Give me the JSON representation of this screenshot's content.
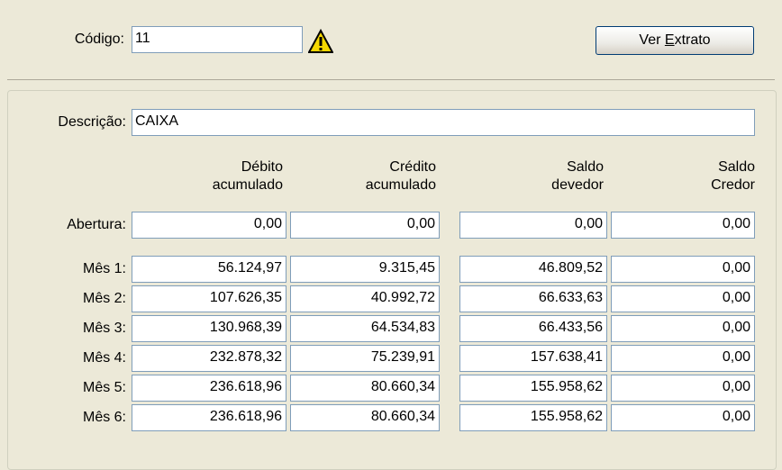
{
  "header": {
    "codigo_label": "Código:",
    "codigo_value": "11",
    "warning_icon": "warning-triangle-icon",
    "button_pre": "Ver ",
    "button_ul": "E",
    "button_post": "xtrato"
  },
  "form": {
    "descricao_label": "Descrição:",
    "descricao_value": "CAIXA",
    "columns": [
      "Débito\nacumulado",
      "Crédito\nacumulado",
      "Saldo\ndevedor",
      "Saldo\nCredor"
    ],
    "rows": [
      {
        "label": "Abertura:",
        "values": [
          "0,00",
          "0,00",
          "0,00",
          "0,00"
        ]
      },
      {
        "label": "Mês 1:",
        "values": [
          "56.124,97",
          "9.315,45",
          "46.809,52",
          "0,00"
        ]
      },
      {
        "label": "Mês 2:",
        "values": [
          "107.626,35",
          "40.992,72",
          "66.633,63",
          "0,00"
        ]
      },
      {
        "label": "Mês 3:",
        "values": [
          "130.968,39",
          "64.534,83",
          "66.433,56",
          "0,00"
        ]
      },
      {
        "label": "Mês 4:",
        "values": [
          "232.878,32",
          "75.239,91",
          "157.638,41",
          "0,00"
        ]
      },
      {
        "label": "Mês 5:",
        "values": [
          "236.618,96",
          "80.660,34",
          "155.958,62",
          "0,00"
        ]
      },
      {
        "label": "Mês 6:",
        "values": [
          "236.618,96",
          "80.660,34",
          "155.958,62",
          "0,00"
        ]
      }
    ]
  }
}
